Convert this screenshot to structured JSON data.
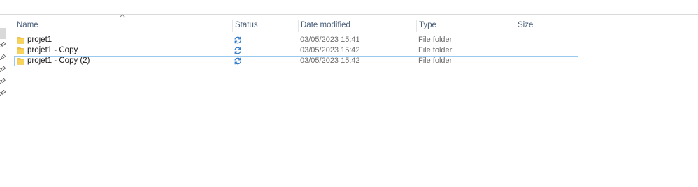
{
  "columns": {
    "name": "Name",
    "status": "Status",
    "date_modified": "Date modified",
    "type": "Type",
    "size": "Size"
  },
  "sort": {
    "column": "Name",
    "icon": "sort-ascending-chevron-icon"
  },
  "colors": {
    "header_text": "#4c607a",
    "folder_yellow": "#f3c33b",
    "sync_blue": "#2e78c7",
    "focus_border": "#99c9ef"
  },
  "files": [
    {
      "name": "projet1",
      "status_icon": "sync-pending-icon",
      "date_modified": "03/05/2023 15:41",
      "type": "File folder",
      "size": ""
    },
    {
      "name": "projet1 - Copy",
      "status_icon": "sync-pending-icon",
      "date_modified": "03/05/2023 15:42",
      "type": "File folder",
      "size": ""
    },
    {
      "name": "projet1 - Copy (2)",
      "status_icon": "sync-pending-icon",
      "date_modified": "03/05/2023 15:42",
      "type": "File folder",
      "size": "",
      "focused": true
    }
  ]
}
